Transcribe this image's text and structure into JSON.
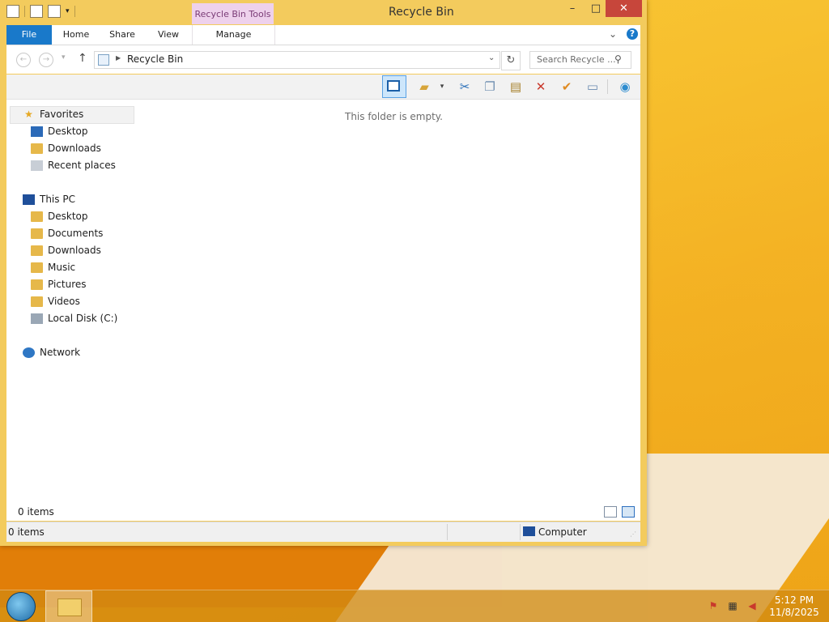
{
  "window": {
    "title": "Recycle Bin",
    "context_tab": "Recycle Bin Tools",
    "minimize": "–",
    "maximize": "□",
    "close": "✕"
  },
  "ribbon": {
    "tabs": [
      {
        "label": "File"
      },
      {
        "label": "Home"
      },
      {
        "label": "Share"
      },
      {
        "label": "View"
      },
      {
        "label": "Manage"
      }
    ],
    "expand": "⌄",
    "help": "?"
  },
  "address": {
    "path": "Recycle Bin",
    "search_placeholder": "Search Recycle ..."
  },
  "nav_pane": {
    "favorites": {
      "label": "Favorites",
      "items": [
        {
          "label": "Desktop"
        },
        {
          "label": "Downloads"
        },
        {
          "label": "Recent places"
        }
      ]
    },
    "this_pc": {
      "label": "This PC",
      "items": [
        {
          "label": "Desktop"
        },
        {
          "label": "Documents"
        },
        {
          "label": "Downloads"
        },
        {
          "label": "Music"
        },
        {
          "label": "Pictures"
        },
        {
          "label": "Videos"
        },
        {
          "label": "Local Disk (C:)"
        }
      ]
    },
    "network": {
      "label": "Network"
    }
  },
  "content": {
    "empty_message": "This folder is empty.",
    "item_count": "0 items"
  },
  "statusbar": {
    "items": "0 items",
    "location": "Computer"
  },
  "taskbar": {
    "time": "5:12 PM",
    "date": "11/8/2025"
  },
  "colors": {
    "accent": "#1979ca",
    "window_frame": "#f3cb5d",
    "close_button": "#c7463b",
    "context_tab": "#eed1ec"
  }
}
